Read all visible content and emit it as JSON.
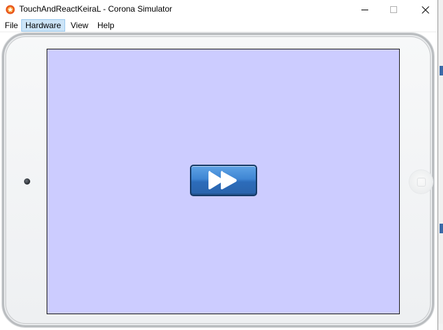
{
  "window": {
    "title": "TouchAndReactKeiraL - Corona Simulator",
    "app_icon": "corona-icon",
    "controls": [
      "minimize-icon",
      "maximize-icon",
      "close-icon"
    ]
  },
  "menubar": {
    "items": [
      {
        "label": "File",
        "active": false
      },
      {
        "label": "Hardware",
        "active": true
      },
      {
        "label": "View",
        "active": false
      },
      {
        "label": "Help",
        "active": false
      }
    ]
  },
  "device": {
    "type": "iPad",
    "screen_background": "#ccccff",
    "frame_color": "#f4f5f6",
    "icons": [
      "camera-icon",
      "home-button-icon"
    ]
  },
  "screen": {
    "play_button": {
      "icon": "fast-forward-icon",
      "color": "#3f86d3",
      "border_color": "#153a66"
    }
  }
}
